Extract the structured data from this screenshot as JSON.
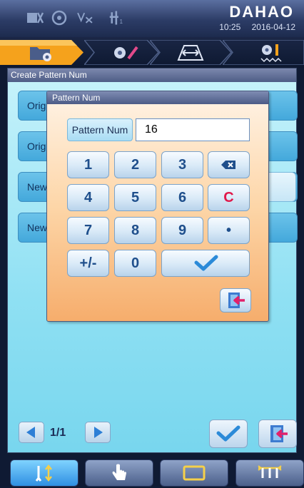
{
  "status": {
    "brand": "DAHAO",
    "time": "10:25",
    "date": "2016-04-12"
  },
  "main": {
    "title": "Create Pattern Num",
    "rows": [
      "Origi",
      "Origi",
      "New",
      "New"
    ],
    "pager": "1/1"
  },
  "dialog": {
    "title": "Pattern Num",
    "field_label": "Pattern Num",
    "field_value": "16",
    "keys": {
      "k1": "1",
      "k2": "2",
      "k3": "3",
      "k4": "4",
      "k5": "5",
      "k6": "6",
      "k7": "7",
      "k8": "8",
      "k9": "9",
      "k0": "0",
      "plusminus": "+/-",
      "clear": "C",
      "dot": "•"
    }
  },
  "colors": {
    "accent_orange": "#f5a21c",
    "check_blue": "#2b8ad8",
    "clear_red": "#e0184a"
  }
}
